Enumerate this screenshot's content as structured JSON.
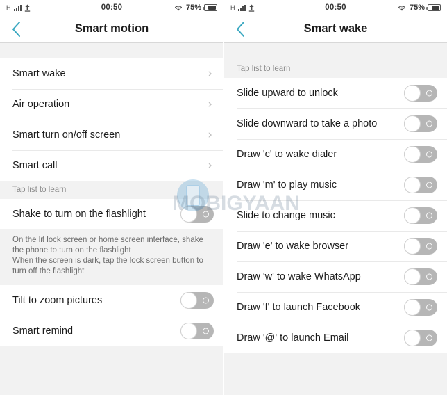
{
  "statusbar": {
    "network_label": "H",
    "signal_icon": "signal-bars-icon",
    "upload_icon": "upload-arrow-icon",
    "time": "00:50",
    "wifi_icon": "wifi-icon",
    "battery_percent": "75%",
    "battery_icon": "battery-icon"
  },
  "watermark": {
    "text": "MOBIGYAAN",
    "logo_icon": "mobile-phone-logo-icon"
  },
  "colors": {
    "accent": "#3aa8c1",
    "toggle_off_track": "#b6b6b6",
    "band": "#f2f2f2",
    "text": "#1c1c1c",
    "muted": "#8e8e8e"
  },
  "left_screen": {
    "title": "Smart motion",
    "back_icon": "chevron-left-icon",
    "nav_items": [
      {
        "label": "Smart wake",
        "chevron": "›"
      },
      {
        "label": "Air operation",
        "chevron": "›"
      },
      {
        "label": "Smart turn on/off screen",
        "chevron": "›"
      },
      {
        "label": "Smart call",
        "chevron": "›"
      }
    ],
    "caption": "Tap list to learn",
    "flashlight_row": {
      "label": "Shake to turn on the flashlight",
      "toggle": "off"
    },
    "help_text": "On the lit lock screen or home screen interface, shake the phone to turn on the flashlight\nWhen the screen is dark, tap the lock screen button to turn off the flashlight",
    "help_lines": [
      "On the lit lock screen or home screen interface, shake",
      "the phone to turn on the flashlight",
      "When the screen is dark, tap the lock screen button to",
      "turn off the flashlight"
    ],
    "toggle_rows": [
      {
        "label": "Tilt to zoom pictures",
        "toggle": "off"
      },
      {
        "label": "Smart remind",
        "toggle": "off"
      }
    ]
  },
  "right_screen": {
    "title": "Smart wake",
    "back_icon": "chevron-left-icon",
    "caption": "Tap list to learn",
    "toggle_rows": [
      {
        "label": "Slide upward to unlock",
        "toggle": "off"
      },
      {
        "label": "Slide downward to take a photo",
        "toggle": "off"
      },
      {
        "label": "Draw 'c' to wake dialer",
        "toggle": "off"
      },
      {
        "label": "Draw 'm' to play music",
        "toggle": "off"
      },
      {
        "label": "Slide to change music",
        "toggle": "off"
      },
      {
        "label": "Draw 'e' to wake browser",
        "toggle": "off"
      },
      {
        "label": "Draw 'w' to wake WhatsApp",
        "toggle": "off"
      },
      {
        "label": "Draw 'f' to launch Facebook",
        "toggle": "off"
      },
      {
        "label": "Draw '@' to launch Email",
        "toggle": "off"
      }
    ]
  }
}
